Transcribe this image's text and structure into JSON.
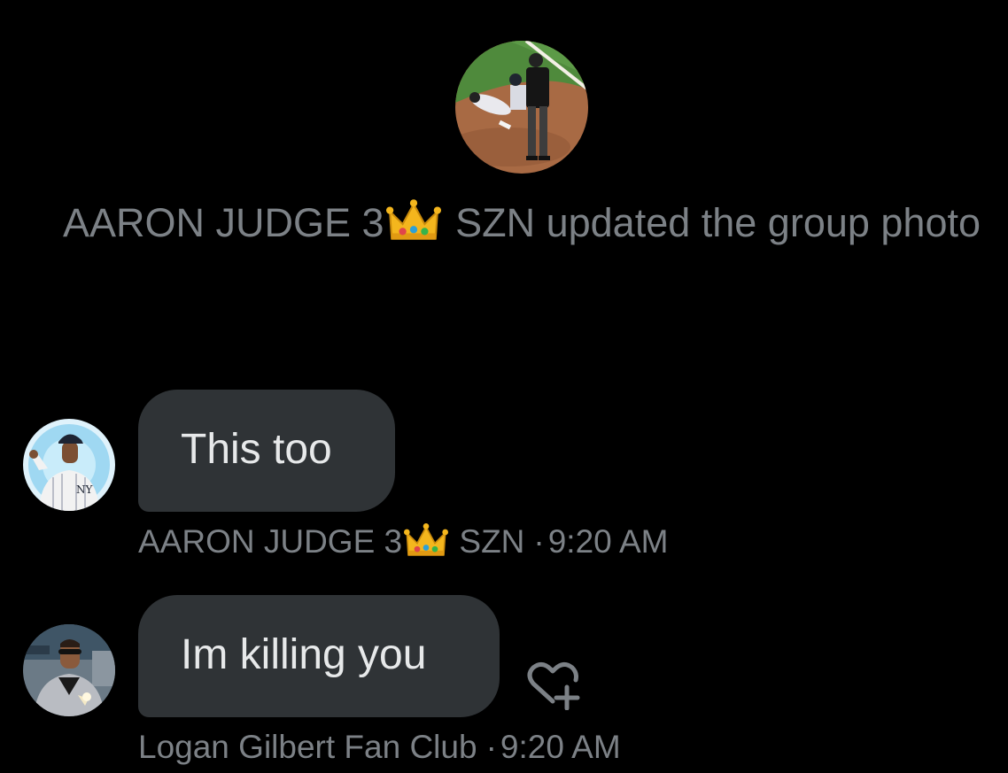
{
  "group_event": {
    "actor_before_crown": "AARON JUDGE 3",
    "actor_after_crown": " SZN",
    "action": " updated the group photo",
    "icon": "crown-emoji"
  },
  "messages": [
    {
      "text": "This too",
      "sender_before_crown": "AARON JUDGE 3",
      "sender_after_crown": " SZN",
      "separator": "·",
      "time": "9:20 AM",
      "avatar": "baseball-player-avatar"
    },
    {
      "text": "Im killing you",
      "sender": "Logan Gilbert Fan Club",
      "separator": "·",
      "time": "9:20 AM",
      "avatar": "man-in-suit-avatar",
      "reaction_icon": "heart-plus-icon"
    }
  ],
  "colors": {
    "background": "#000000",
    "bubble": "#2f3336",
    "text": "#e7e9ea",
    "muted": "#7c8186"
  }
}
